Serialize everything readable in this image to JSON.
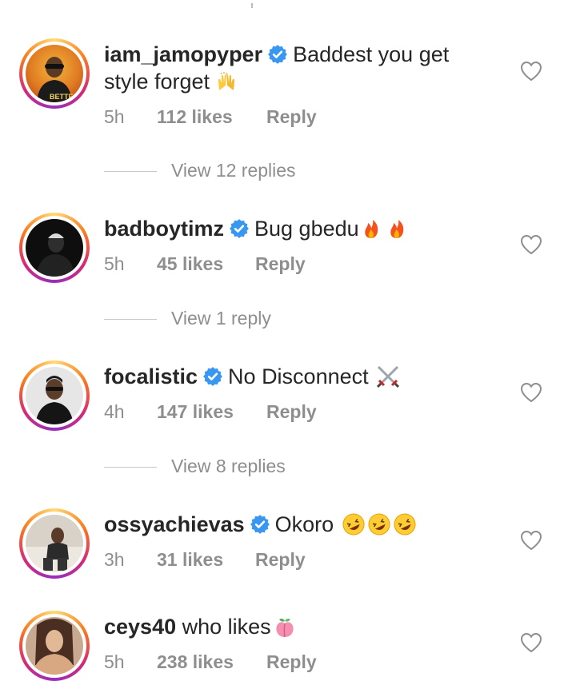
{
  "comments": [
    {
      "username": "iam_jamopyper",
      "verified": true,
      "text_line1": "Baddest you get",
      "text_line2": "style forget",
      "emoji": "raising-hands",
      "time": "5h",
      "likes": "112 likes",
      "reply": "Reply",
      "view_replies": "View 12 replies",
      "avatar_colors": [
        "#e8a02a",
        "#c5411c"
      ]
    },
    {
      "username": "badboytimz",
      "verified": true,
      "text_line1": "Bug gbedu",
      "emoji": "fire-fire",
      "time": "5h",
      "likes": "45 likes",
      "reply": "Reply",
      "view_replies": "View 1 reply",
      "avatar_colors": [
        "#1a1a1a",
        "#3a3a3a"
      ]
    },
    {
      "username": "focalistic",
      "verified": true,
      "text_line1": "No Disconnect",
      "emoji": "crossed-swords",
      "time": "4h",
      "likes": "147 likes",
      "reply": "Reply",
      "view_replies": "View 8 replies",
      "avatar_colors": [
        "#dcdcdc",
        "#2a2a2a"
      ]
    },
    {
      "username": "ossyachievas",
      "verified": true,
      "text_line1": "Okoro",
      "emoji": "rofl-x3",
      "time": "3h",
      "likes": "31 likes",
      "reply": "Reply",
      "avatar_colors": [
        "#e9e4dc",
        "#444444"
      ]
    },
    {
      "username": "ceys40",
      "verified": false,
      "text_line1": "who likes",
      "emoji": "peach",
      "time": "5h",
      "likes": "238 likes",
      "reply": "Reply",
      "avatar_colors": [
        "#d9b89c",
        "#6b4a3a"
      ]
    }
  ],
  "colors": {
    "text": "#262626",
    "secondary": "#8e8e8e",
    "verified_blue": "#3897f0"
  }
}
